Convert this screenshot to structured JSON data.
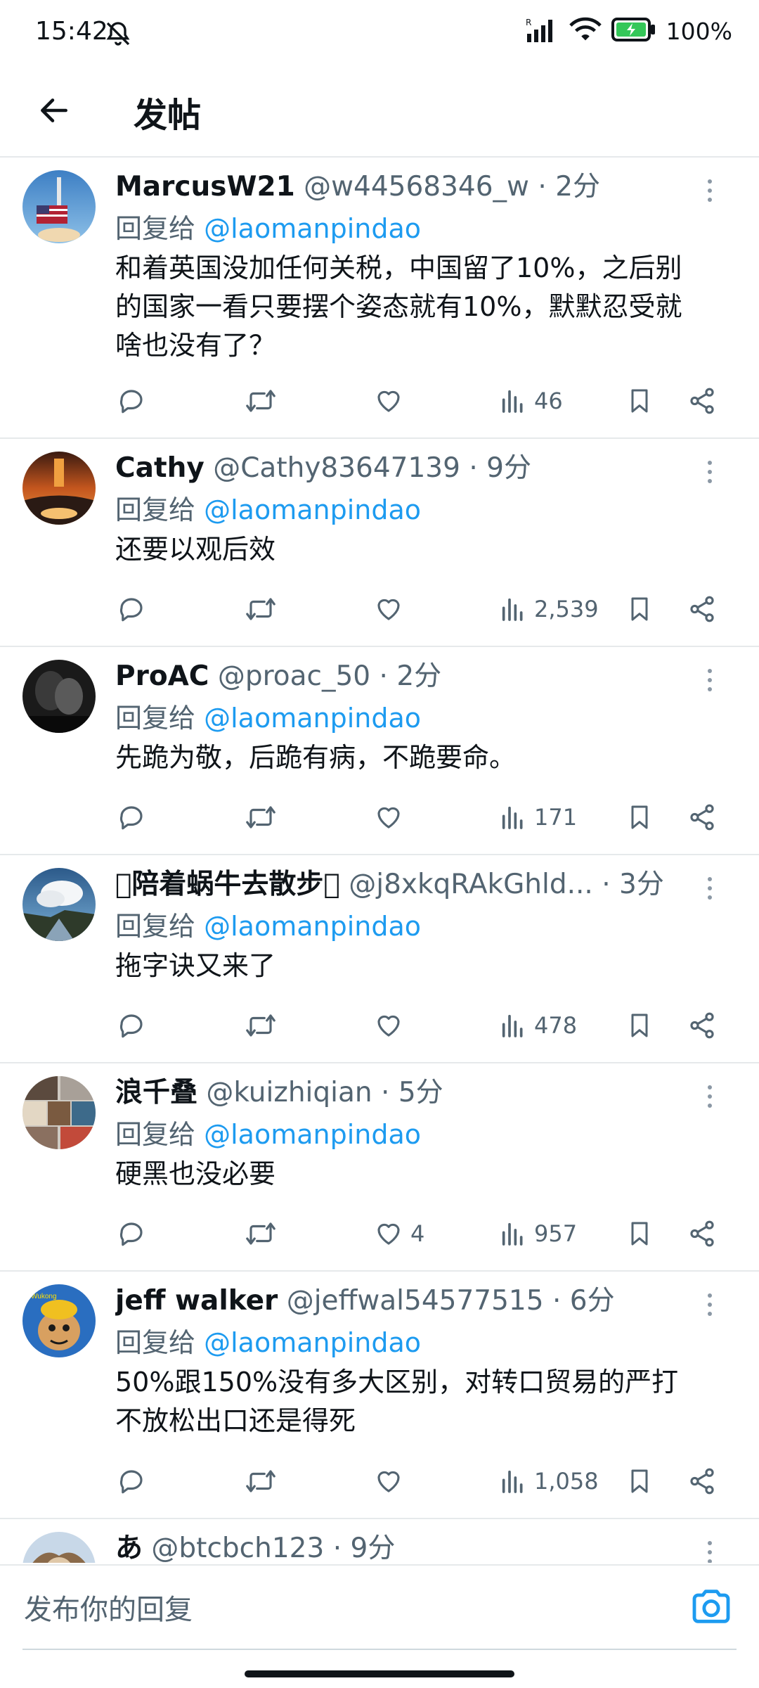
{
  "status_bar": {
    "time": "15:42",
    "battery": "100%"
  },
  "header": {
    "title": "发帖"
  },
  "posts": [
    {
      "name": "MarcusW21",
      "handle": "@w44568346_w",
      "dot": "·",
      "time": "2分",
      "reply_prefix": "回复给",
      "reply_to": "@laomanpindao",
      "text_lines": [
        "和着英国没加任何关税，中国留了10%，之后别",
        "的国家一看只要摆个姿态就有10%，默默忍受就",
        "啥也没有了？"
      ],
      "likes": "",
      "views": "46",
      "avatar": "rocket-flag"
    },
    {
      "name": "Cathy",
      "handle": "@Cathy83647139",
      "dot": "·",
      "time": "9分",
      "reply_prefix": "回复给",
      "reply_to": "@laomanpindao",
      "text_lines": [
        "还要以观后效"
      ],
      "likes": "",
      "views": "2,539",
      "avatar": "canyon-sunset"
    },
    {
      "name": "ProAC",
      "handle": "@proac_50",
      "dot": "·",
      "time": "2分",
      "reply_prefix": "回复给",
      "reply_to": "@laomanpindao",
      "text_lines": [
        "先跪为敬，后跪有病，不跪要命。"
      ],
      "likes": "",
      "views": "171",
      "avatar": "dark-couple"
    },
    {
      "name": "陪着蜗牛去散步",
      "handle": "@j8xkqRAkGhld...",
      "dot": "·",
      "time": "3分",
      "reply_prefix": "回复给",
      "reply_to": "@laomanpindao",
      "text_lines": [
        "拖字诀又来了"
      ],
      "likes": "",
      "views": "478",
      "avatar": "cloud-landscape"
    },
    {
      "name": "浪千叠",
      "handle": "@kuizhiqian",
      "dot": "·",
      "time": "5分",
      "reply_prefix": "回复给",
      "reply_to": "@laomanpindao",
      "text_lines": [
        "硬黑也没必要"
      ],
      "likes": "4",
      "views": "957",
      "avatar": "collage"
    },
    {
      "name": "jeff walker",
      "handle": "@jeffwal54577515",
      "dot": "·",
      "time": "6分",
      "reply_prefix": "回复给",
      "reply_to": "@laomanpindao",
      "text_lines": [
        "50%跟150%没有多大区别，对转口贸易的严打",
        "不放松出口还是得死"
      ],
      "likes": "",
      "views": "1,058",
      "avatar": "cartoon-monkey"
    },
    {
      "name": "あ",
      "handle": "@btcbch123",
      "dot": "·",
      "time": "9分",
      "reply_prefix": "",
      "reply_to": "",
      "text_lines": [],
      "likes": "",
      "views": "",
      "avatar": "partial"
    }
  ],
  "compose": {
    "placeholder": "发布你的回复"
  },
  "colors": {
    "accent": "#1d9bf0",
    "text": "#0f1419",
    "secondary": "#536471",
    "divider": "#e6e9eb"
  }
}
